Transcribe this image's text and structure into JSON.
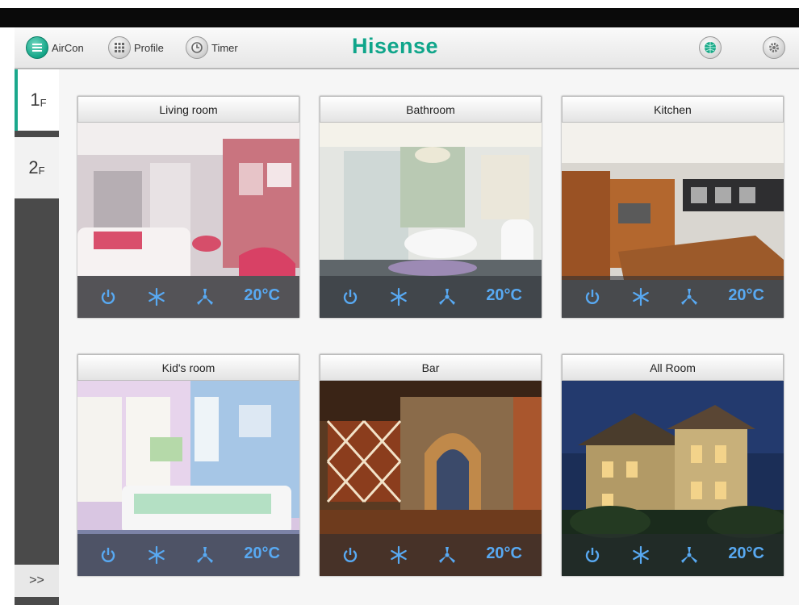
{
  "header": {
    "nav": [
      {
        "label": "AirCon",
        "icon": "list-icon"
      },
      {
        "label": "Profile",
        "icon": "grid-icon"
      },
      {
        "label": "Timer",
        "icon": "clock-icon"
      }
    ],
    "logo": "Hisense",
    "right_icons": [
      "globe-icon",
      "gear-icon"
    ],
    "colors": {
      "accent": "#0fa58a",
      "temperature": "#58a9f2"
    }
  },
  "sidebar": {
    "floors": [
      {
        "num": "1",
        "suffix": "F",
        "active": true
      },
      {
        "num": "2",
        "suffix": "F",
        "active": false
      }
    ],
    "expand_label": ">>"
  },
  "rooms": [
    {
      "name": "Living room",
      "temp": "20°C"
    },
    {
      "name": "Bathroom",
      "temp": "20°C"
    },
    {
      "name": "Kitchen",
      "temp": "20°C"
    },
    {
      "name": "Kid's room",
      "temp": "20°C"
    },
    {
      "name": "Bar",
      "temp": "20°C"
    },
    {
      "name": "All Room",
      "temp": "20°C"
    }
  ]
}
